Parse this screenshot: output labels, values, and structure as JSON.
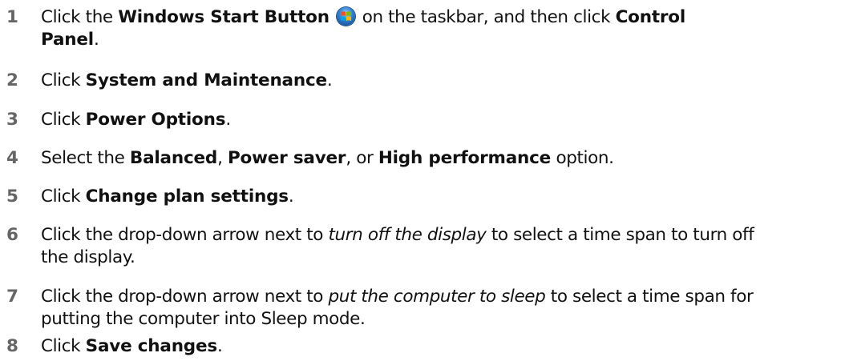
{
  "steps": [
    {
      "number": "1",
      "parts": [
        "Click the ",
        "Windows Start Button",
        " on the taskbar, and then click ",
        "Control",
        "Panel",
        "."
      ],
      "icon": "windows-start-orb-icon"
    },
    {
      "number": "2",
      "parts": [
        "Click ",
        "System and Maintenance",
        "."
      ]
    },
    {
      "number": "3",
      "parts": [
        "Click ",
        "Power Options",
        "."
      ]
    },
    {
      "number": "4",
      "parts": [
        "Select the ",
        "Balanced",
        ", ",
        "Power saver",
        ", or ",
        "High performance",
        " option."
      ]
    },
    {
      "number": "5",
      "parts": [
        "Click ",
        "Change plan settings",
        "."
      ]
    },
    {
      "number": "6",
      "parts": [
        "Click the drop-down arrow next to ",
        "turn off the display",
        " to select a time span to turn off",
        "the display."
      ]
    },
    {
      "number": "7",
      "parts": [
        "Click the drop-down arrow next to ",
        "put the computer to sleep",
        " to select a time span for",
        "putting the computer into Sleep mode."
      ]
    },
    {
      "number": "8",
      "parts": [
        "Click ",
        "Save changes",
        "."
      ]
    }
  ],
  "colors": {
    "step_number": "#666666",
    "text": "#111111",
    "orb_blue": "#2f7fd1"
  }
}
